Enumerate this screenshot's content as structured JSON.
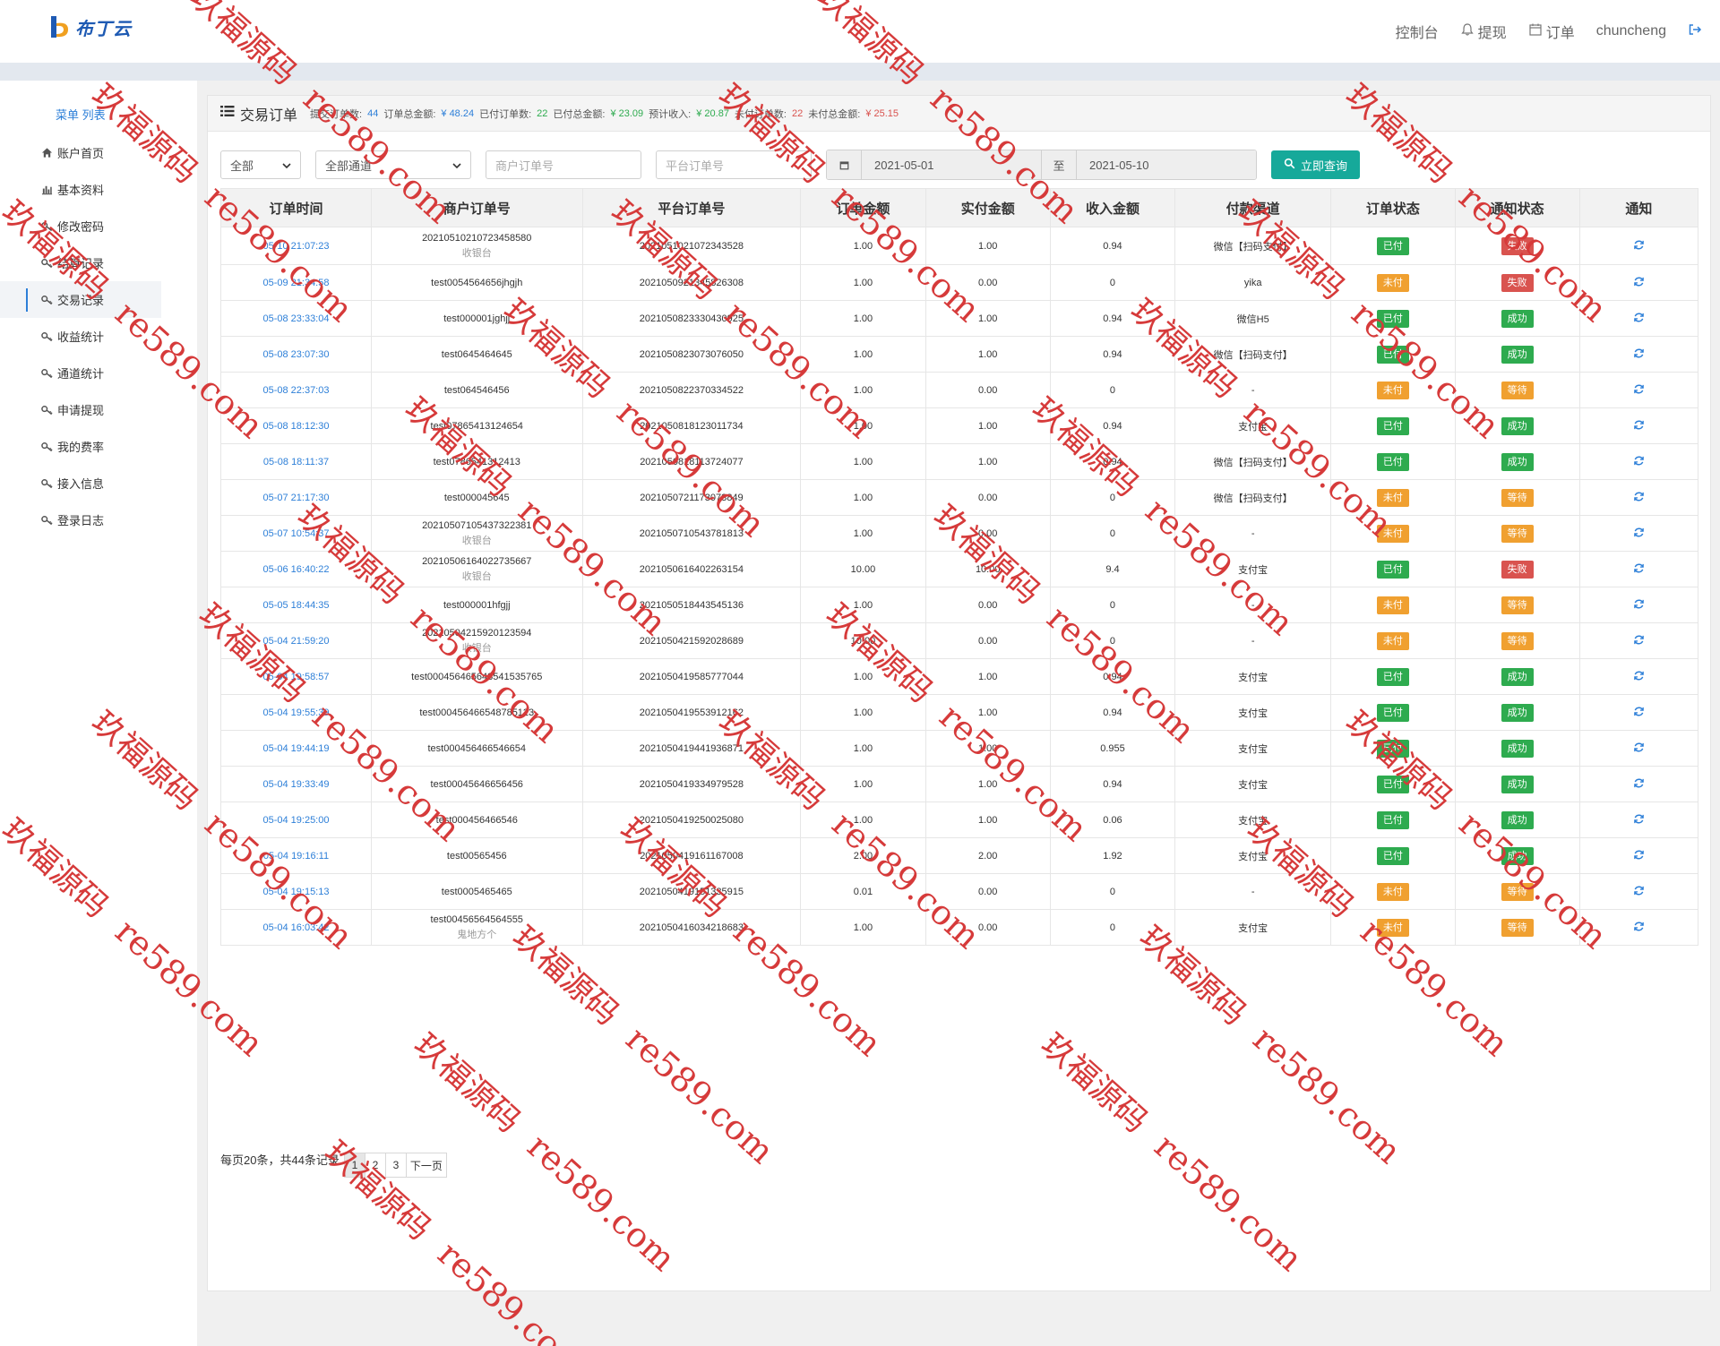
{
  "brand": {
    "name": "布丁云"
  },
  "topnav": {
    "dashboard": "控制台",
    "withdraw": "提现",
    "orders": "订单",
    "user": "chuncheng"
  },
  "sidebar": {
    "title": "菜单 列表",
    "items": [
      {
        "label": "账户首页",
        "icon": "home-icon"
      },
      {
        "label": "基本资料",
        "icon": "bar-chart-icon"
      },
      {
        "label": "修改密码",
        "icon": "key-icon"
      },
      {
        "label": "结算记录",
        "icon": "key-icon"
      },
      {
        "label": "交易记录",
        "icon": "key-icon",
        "active": true
      },
      {
        "label": "收益统计",
        "icon": "key-icon"
      },
      {
        "label": "通道统计",
        "icon": "key-icon"
      },
      {
        "label": "申请提现",
        "icon": "key-icon"
      },
      {
        "label": "我的费率",
        "icon": "key-icon"
      },
      {
        "label": "接入信息",
        "icon": "key-icon"
      },
      {
        "label": "登录日志",
        "icon": "key-icon"
      }
    ]
  },
  "panel": {
    "title": "交易订单",
    "stats": {
      "submit_count_label": "提交订单数:",
      "submit_count": "44",
      "total_amount_label": "订单总金额:",
      "total_amount": "¥ 48.24",
      "paid_count_label": "已付订单数:",
      "paid_count": "22",
      "paid_amount_label": "已付总金额:",
      "paid_amount": "¥ 23.09",
      "income_label": "预计收入:",
      "income": "¥ 20.87",
      "unpaid_count_label": "未付订单数:",
      "unpaid_count": "22",
      "unpaid_amount_label": "未付总金额:",
      "unpaid_amount": "¥ 25.15"
    }
  },
  "filters": {
    "status_select": "全部",
    "channel_select": "全部通道",
    "merchant_order_placeholder": "商户订单号",
    "platform_order_placeholder": "平台订单号",
    "date_from": "2021-05-01",
    "date_to_label": "至",
    "date_to": "2021-05-10",
    "query_button": "立即查询"
  },
  "table": {
    "columns": [
      "订单时间",
      "商户订单号",
      "平台订单号",
      "订单金额",
      "实付金额",
      "收入金额",
      "付款渠道",
      "订单状态",
      "通知状态",
      "通知"
    ],
    "rows": [
      {
        "time": "05-10 21:07:23",
        "merchant": "20210510210723458580",
        "merchant_sub": "收银台",
        "platform": "202105102107234352​8",
        "amount": "1.00",
        "paid": "1.00",
        "income": "0.94",
        "channel": "微信【扫码支付】",
        "status": "已付",
        "status_color": "green",
        "notify": "失败",
        "notify_color": "red"
      },
      {
        "time": "05-09 21:34:58",
        "merchant": "test0054564656jhgjh",
        "merchant_sub": "",
        "platform": "202105092134582630​8",
        "amount": "1.00",
        "paid": "0.00",
        "income": "0",
        "channel": "yika",
        "status": "未付",
        "status_color": "orange",
        "notify": "失败",
        "notify_color": "red"
      },
      {
        "time": "05-08 23:33:04",
        "merchant": "test000001jghjj",
        "merchant_sub": "",
        "platform": "2021050823330430925",
        "amount": "1.00",
        "paid": "1.00",
        "income": "0.94",
        "channel": "微信H5",
        "status": "已付",
        "status_color": "green",
        "notify": "成功",
        "notify_color": "green"
      },
      {
        "time": "05-08 23:07:30",
        "merchant": "test0645464645",
        "merchant_sub": "",
        "platform": "2021050823073076050",
        "amount": "1.00",
        "paid": "1.00",
        "income": "0.94",
        "channel": "微信【扫码支付】",
        "status": "已付",
        "status_color": "green",
        "notify": "成功",
        "notify_color": "green"
      },
      {
        "time": "05-08 22:37:03",
        "merchant": "test064546456",
        "merchant_sub": "",
        "platform": "2021050822370334522",
        "amount": "1.00",
        "paid": "0.00",
        "income": "0",
        "channel": "-",
        "status": "未付",
        "status_color": "orange",
        "notify": "等待",
        "notify_color": "orange"
      },
      {
        "time": "05-08 18:12:30",
        "merchant": "test07865413124654",
        "merchant_sub": "",
        "platform": "2021050818123011734",
        "amount": "1.00",
        "paid": "1.00",
        "income": "0.94",
        "channel": "支付宝",
        "status": "已付",
        "status_color": "green",
        "notify": "成功",
        "notify_color": "green"
      },
      {
        "time": "05-08 18:11:37",
        "merchant": "test0786541312413",
        "merchant_sub": "",
        "platform": "2021050818113724077",
        "amount": "1.00",
        "paid": "1.00",
        "income": "0.94",
        "channel": "微信【扫码支付】",
        "status": "已付",
        "status_color": "green",
        "notify": "成功",
        "notify_color": "green"
      },
      {
        "time": "05-07 21:17:30",
        "merchant": "test000045645",
        "merchant_sub": "",
        "platform": "2021050721173073849",
        "amount": "1.00",
        "paid": "0.00",
        "income": "0",
        "channel": "微信【扫码支付】",
        "status": "未付",
        "status_color": "orange",
        "notify": "等待",
        "notify_color": "orange"
      },
      {
        "time": "05-07 10:54:37",
        "merchant": "20210507105437322381",
        "merchant_sub": "收银台",
        "platform": "2021050710543781813",
        "amount": "1.00",
        "paid": "0.00",
        "income": "0",
        "channel": "-",
        "status": "未付",
        "status_color": "orange",
        "notify": "等待",
        "notify_color": "orange"
      },
      {
        "time": "05-06 16:40:22",
        "merchant": "20210506164022735667",
        "merchant_sub": "收银台",
        "platform": "2021050616402263154",
        "amount": "10.00",
        "paid": "10.00",
        "income": "9.4",
        "channel": "支付宝",
        "status": "已付",
        "status_color": "green",
        "notify": "失败",
        "notify_color": "red"
      },
      {
        "time": "05-05 18:44:35",
        "merchant": "test000001hfgjj",
        "merchant_sub": "",
        "platform": "2021050518443545136",
        "amount": "1.00",
        "paid": "0.00",
        "income": "0",
        "channel": "-",
        "status": "未付",
        "status_color": "orange",
        "notify": "等待",
        "notify_color": "orange"
      },
      {
        "time": "05-04 21:59:20",
        "merchant": "20210504215920123594",
        "merchant_sub": "收银台",
        "platform": "2021050421592028689",
        "amount": "10.00",
        "paid": "0.00",
        "income": "0",
        "channel": "-",
        "status": "未付",
        "status_color": "orange",
        "notify": "等待",
        "notify_color": "orange"
      },
      {
        "time": "05-04 19:58:57",
        "merchant": "test000456465648541535765",
        "merchant_sub": "",
        "platform": "2021050419585777044",
        "amount": "1.00",
        "paid": "1.00",
        "income": "0.94",
        "channel": "支付宝",
        "status": "已付",
        "status_color": "green",
        "notify": "成功",
        "notify_color": "green"
      },
      {
        "time": "05-04 19:55:39",
        "merchant": "test000456466548785123",
        "merchant_sub": "",
        "platform": "2021050419553912162",
        "amount": "1.00",
        "paid": "1.00",
        "income": "0.94",
        "channel": "支付宝",
        "status": "已付",
        "status_color": "green",
        "notify": "成功",
        "notify_color": "green"
      },
      {
        "time": "05-04 19:44:19",
        "merchant": "test000456466546654",
        "merchant_sub": "",
        "platform": "2021050419441936871",
        "amount": "1.00",
        "paid": "1.00",
        "income": "0.955",
        "channel": "支付宝",
        "status": "已付",
        "status_color": "green",
        "notify": "成功",
        "notify_color": "green"
      },
      {
        "time": "05-04 19:33:49",
        "merchant": "test00045646656456",
        "merchant_sub": "",
        "platform": "2021050419334979528",
        "amount": "1.00",
        "paid": "1.00",
        "income": "0.94",
        "channel": "支付宝",
        "status": "已付",
        "status_color": "green",
        "notify": "成功",
        "notify_color": "green"
      },
      {
        "time": "05-04 19:25:00",
        "merchant": "test000456466546",
        "merchant_sub": "",
        "platform": "2021050419250025080",
        "amount": "1.00",
        "paid": "1.00",
        "income": "0.06",
        "channel": "支付宝",
        "status": "已付",
        "status_color": "green",
        "notify": "成功",
        "notify_color": "green"
      },
      {
        "time": "05-04 19:16:11",
        "merchant": "test00565456",
        "merchant_sub": "",
        "platform": "2021050419161167008",
        "amount": "2.00",
        "paid": "2.00",
        "income": "1.92",
        "channel": "支付宝",
        "status": "已付",
        "status_color": "green",
        "notify": "成功",
        "notify_color": "green"
      },
      {
        "time": "05-04 19:15:13",
        "merchant": "test0005465465",
        "merchant_sub": "",
        "platform": "2021050419151335915",
        "amount": "0.01",
        "paid": "0.00",
        "income": "0",
        "channel": "-",
        "status": "未付",
        "status_color": "orange",
        "notify": "等待",
        "notify_color": "orange"
      },
      {
        "time": "05-04 16:03:42",
        "merchant": "test004565645645​55",
        "merchant_sub": "鬼地方个",
        "platform": "2021050416034218683",
        "amount": "1.00",
        "paid": "0.00",
        "income": "0",
        "channel": "支付宝",
        "status": "未付",
        "status_color": "orange",
        "notify": "等待",
        "notify_color": "orange"
      }
    ]
  },
  "pager": {
    "info": "每页20条，共44条记录",
    "pages": [
      "1",
      "2",
      "3"
    ],
    "next": "下一页"
  },
  "watermark": {
    "text_cn": "玖福源码",
    "text_url": "re589.com"
  },
  "colors": {
    "accent": "#2d7fd8",
    "success": "#2eab4f",
    "warning": "#f0a030",
    "danger": "#d9534f",
    "query": "#16a99a"
  }
}
